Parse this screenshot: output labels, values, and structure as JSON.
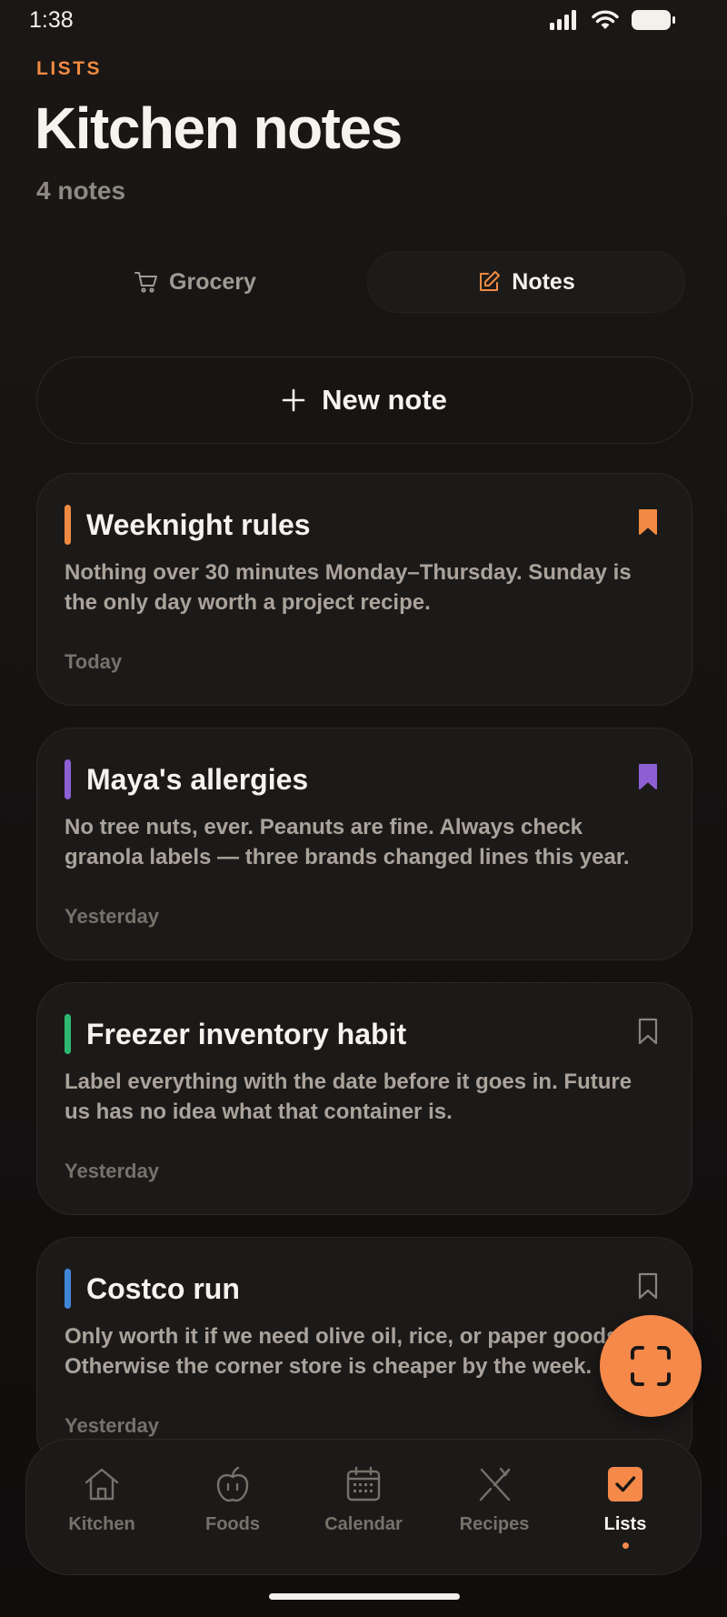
{
  "status_bar": {
    "time": "1:38"
  },
  "header": {
    "eyebrow": "LISTS",
    "title": "Kitchen notes",
    "subtitle": "4 notes"
  },
  "segments": [
    {
      "label": "Grocery",
      "icon": "cart-icon",
      "active": false
    },
    {
      "label": "Notes",
      "icon": "edit-note-icon",
      "active": true
    }
  ],
  "new_note": {
    "label": "New note"
  },
  "notes": [
    {
      "title": "Weeknight rules",
      "body": "Nothing over 30 minutes Monday–Thursday. Sunday is the only day worth a project recipe.",
      "date": "Today",
      "accent": "#f08a42",
      "bookmarked": true
    },
    {
      "title": "Maya's allergies",
      "body": "No tree nuts, ever. Peanuts are fine. Always check granola labels — three brands changed lines this year.",
      "date": "Yesterday",
      "accent": "#8d5fd3",
      "bookmarked": true
    },
    {
      "title": "Freezer inventory habit",
      "body": "Label everything with the date before it goes in. Future us has no idea what that container is.",
      "date": "Yesterday",
      "accent": "#2fb872",
      "bookmarked": false
    },
    {
      "title": "Costco run",
      "body": "Only worth it if we need olive oil, rice, or paper goods. Otherwise the corner store is cheaper by the week.",
      "date": "Yesterday",
      "accent": "#3f86d9",
      "bookmarked": false
    }
  ],
  "fab": {
    "icon": "scan-icon"
  },
  "tabs": [
    {
      "label": "Kitchen",
      "icon": "house-icon",
      "active": false
    },
    {
      "label": "Foods",
      "icon": "apple-icon",
      "active": false
    },
    {
      "label": "Calendar",
      "icon": "calendar-icon",
      "active": false
    },
    {
      "label": "Recipes",
      "icon": "utensils-icon",
      "active": false
    },
    {
      "label": "Lists",
      "icon": "checkbox-icon",
      "active": true
    }
  ],
  "colors": {
    "accent": "#f5894a",
    "background": "#141211",
    "card": "#1c1a19",
    "muted_text": "#77716b"
  }
}
